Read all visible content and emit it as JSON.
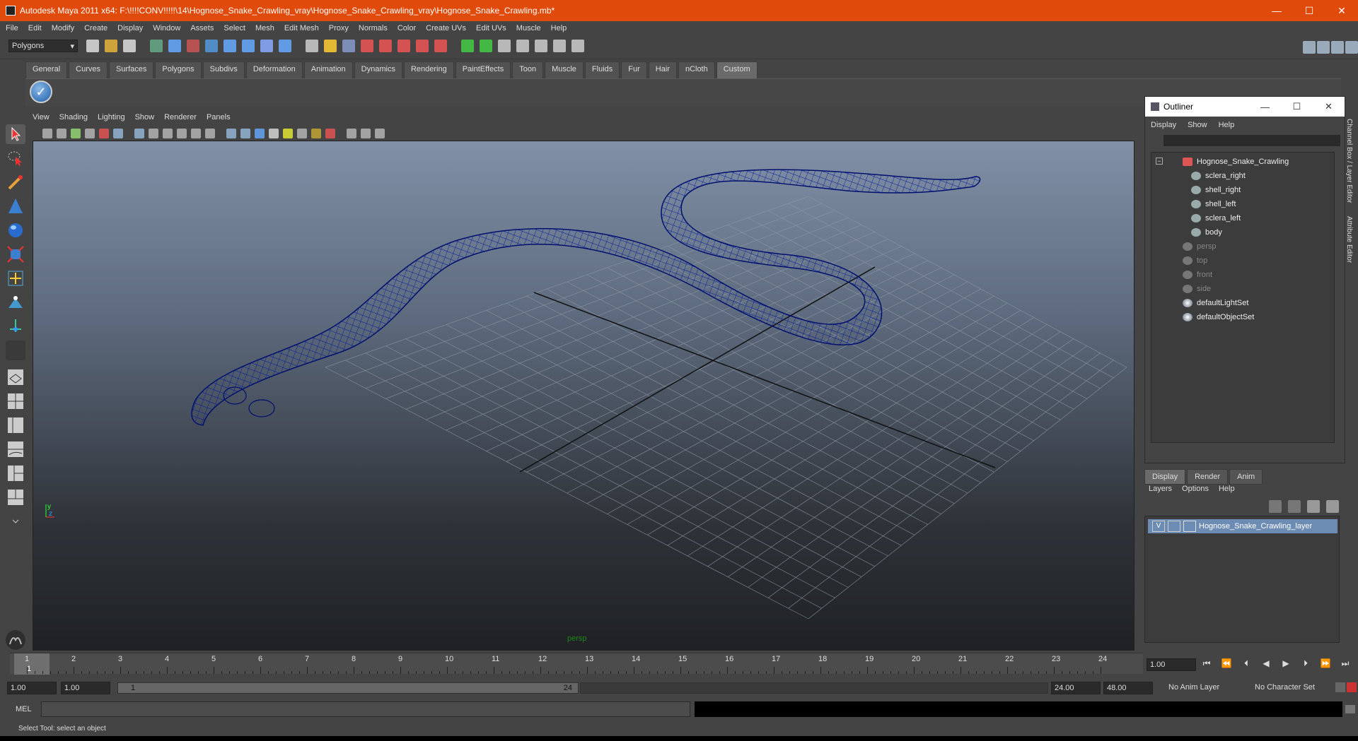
{
  "window": {
    "title": "Autodesk Maya 2011 x64: F:\\!!!!CONV!!!!!\\14\\Hognose_Snake_Crawling_vray\\Hognose_Snake_Crawling_vray\\Hognose_Snake_Crawling.mb*",
    "minimize": "—",
    "maximize": "☐",
    "close": "✕"
  },
  "menubar": [
    "File",
    "Edit",
    "Modify",
    "Create",
    "Display",
    "Window",
    "Assets",
    "Select",
    "Mesh",
    "Edit Mesh",
    "Proxy",
    "Normals",
    "Color",
    "Create UVs",
    "Edit UVs",
    "Muscle",
    "Help"
  ],
  "mode_selector": "Polygons",
  "shelf_tabs": [
    "General",
    "Curves",
    "Surfaces",
    "Polygons",
    "Subdivs",
    "Deformation",
    "Animation",
    "Dynamics",
    "Rendering",
    "PaintEffects",
    "Toon",
    "Muscle",
    "Fluids",
    "Fur",
    "Hair",
    "nCloth",
    "Custom"
  ],
  "shelf_active": "Custom",
  "viewport": {
    "menu": [
      "View",
      "Shading",
      "Lighting",
      "Show",
      "Renderer",
      "Panels"
    ],
    "camera_label": "persp"
  },
  "outliner": {
    "title": "Outliner",
    "menu": [
      "Display",
      "Show",
      "Help"
    ],
    "items": [
      {
        "label": "Hognose_Snake_Crawling",
        "dim": false
      },
      {
        "label": "sclera_right",
        "dim": false
      },
      {
        "label": "shell_right",
        "dim": false
      },
      {
        "label": "shell_left",
        "dim": false
      },
      {
        "label": "sclera_left",
        "dim": false
      },
      {
        "label": "body",
        "dim": false
      },
      {
        "label": "persp",
        "dim": true
      },
      {
        "label": "top",
        "dim": true
      },
      {
        "label": "front",
        "dim": true
      },
      {
        "label": "side",
        "dim": true
      },
      {
        "label": "defaultLightSet",
        "dim": false
      },
      {
        "label": "defaultObjectSet",
        "dim": false
      }
    ]
  },
  "layer_editor": {
    "tabs": [
      "Display",
      "Render",
      "Anim"
    ],
    "menu": [
      "Layers",
      "Options",
      "Help"
    ],
    "layer": {
      "visible": "V",
      "name": "Hognose_Snake_Crawling_layer"
    }
  },
  "timeline": {
    "frames": [
      "1",
      "2",
      "3",
      "4",
      "5",
      "6",
      "7",
      "8",
      "9",
      "10",
      "11",
      "12",
      "13",
      "14",
      "15",
      "16",
      "17",
      "18",
      "19",
      "20",
      "21",
      "22",
      "23",
      "24"
    ],
    "current_frame": "1",
    "current_field": "1.00",
    "playback": [
      "⏮",
      "⏪",
      "⏴",
      "◀",
      "▶",
      "⏵",
      "⏩",
      "⏭"
    ]
  },
  "range": {
    "start": "1.00",
    "playback_start": "1.00",
    "slider_start": "1",
    "slider_end": "24",
    "playback_end": "24.00",
    "end": "48.00",
    "anim_layer": "No Anim Layer",
    "character_set": "No Character Set"
  },
  "command_line": {
    "label": "MEL",
    "value": ""
  },
  "helpline": "Select Tool: select an object",
  "right_tabs": [
    "Channel Box / Layer Editor",
    "Attribute Editor"
  ],
  "colors": {
    "title_bar": "#e04a0a",
    "wireframe": "#000080",
    "selected_layer": "#6d8cb4"
  }
}
